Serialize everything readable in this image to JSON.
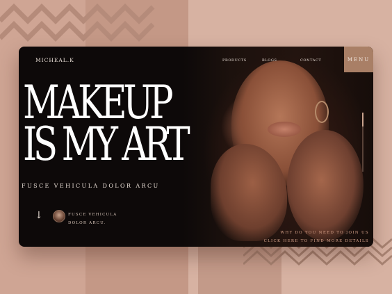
{
  "brand": {
    "logo": "MICHEAL.K"
  },
  "nav": {
    "products": "PRODUCTS",
    "blogs": "BLOGS",
    "contact": "CONTACT",
    "menu": "MENU"
  },
  "hero": {
    "headline_line1": "MAKEUP",
    "headline_line2": "IS MY ART",
    "subtitle": "FUSCE VEHICULA DOLOR ARCU"
  },
  "feature": {
    "line1": "FUSCE VEHICULA",
    "line2": "DOLOR ARCU."
  },
  "cta": {
    "line1": "WHY DO YOU NEED TO JOIN US",
    "line2": "CLICK HERE TO FIND MORE DETAILS"
  },
  "icons": {
    "scroll": "arrow-down-icon",
    "avatar": "avatar"
  },
  "colors": {
    "card": "#0d0909",
    "accent": "#a97f66",
    "background": "#d9b3a3",
    "cta": "#d9a48c"
  }
}
